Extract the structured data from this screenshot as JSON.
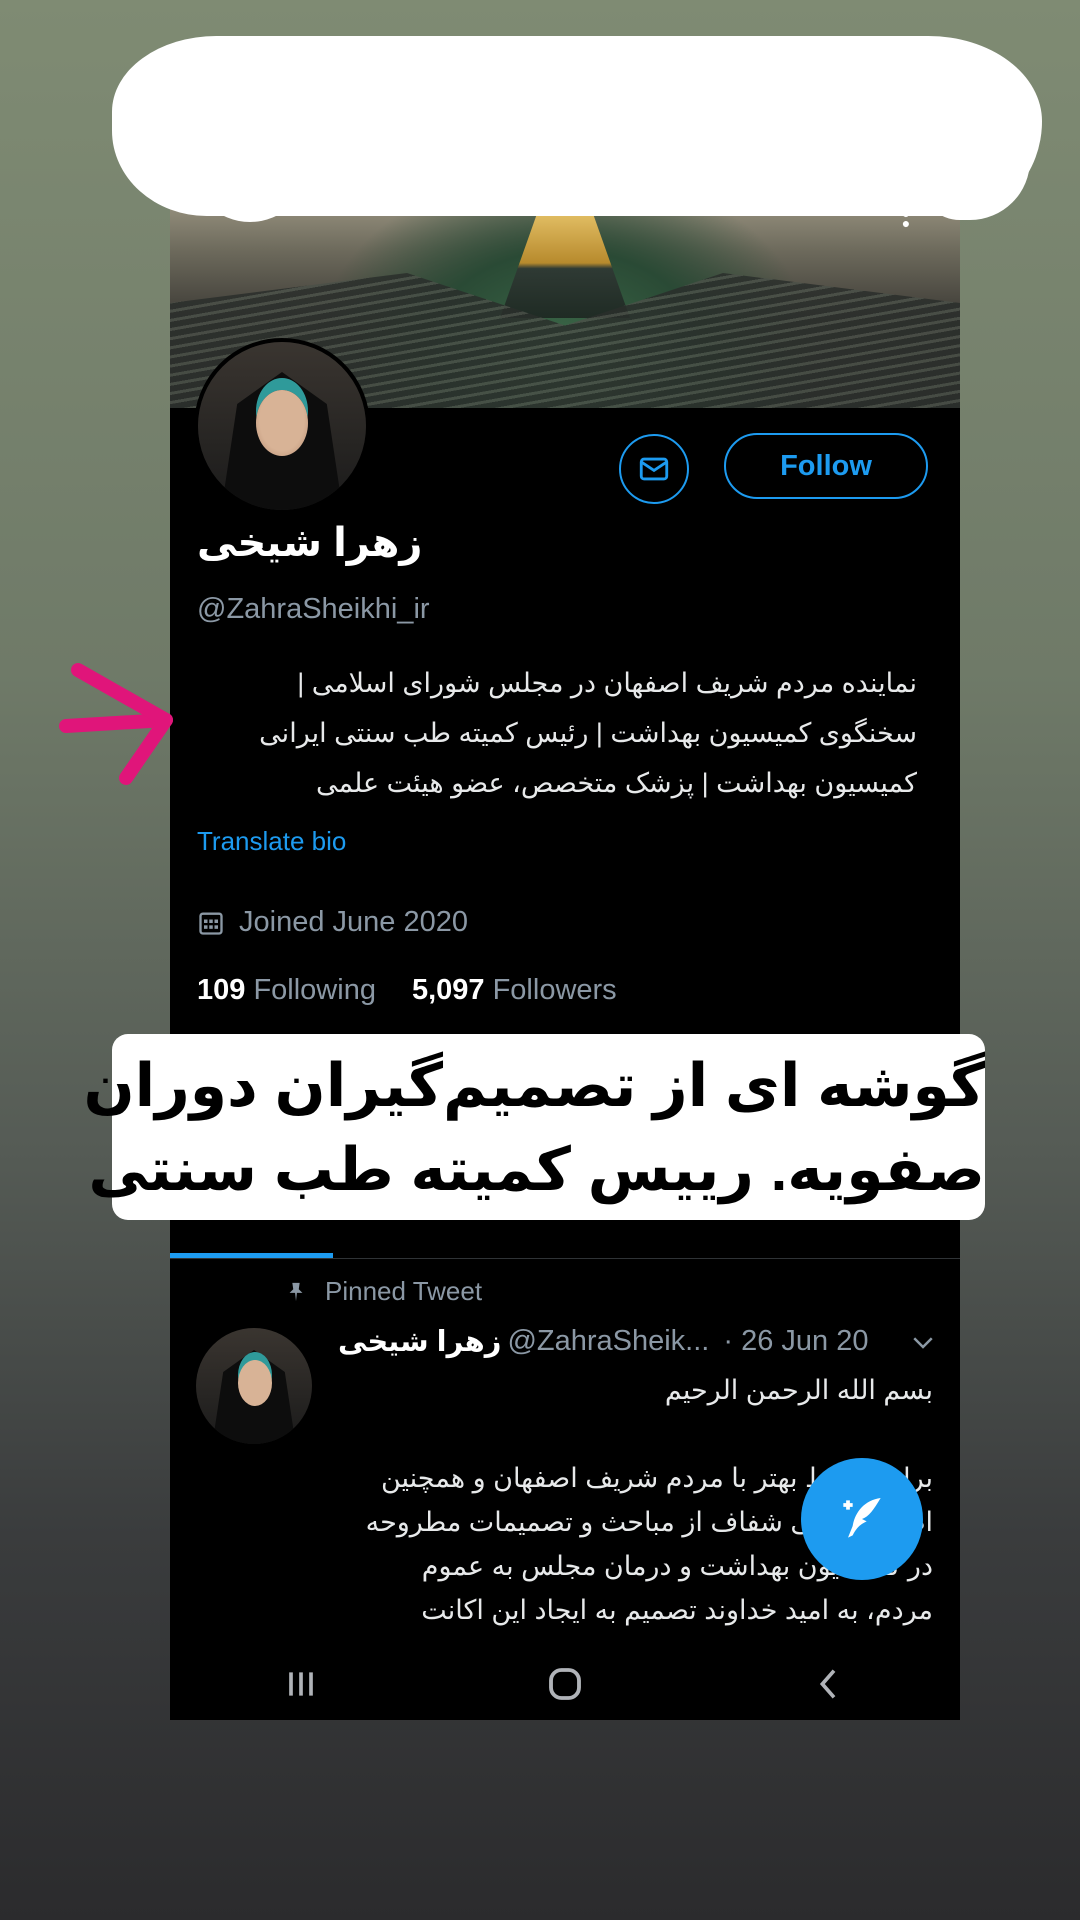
{
  "profile": {
    "follow_label": "Follow",
    "name": "زهرا شیخی",
    "handle": "@ZahraSheikhi_ir",
    "bio": [
      "نماینده مردم شریف اصفهان در مجلس شورای اسلامی |",
      "سخنگوی کمیسیون بهداشت | رئیس کمیته طب سنتی ایرانی",
      "کمیسیون بهداشت | پزشک متخصص، عضو هیئت علمی"
    ],
    "translate_label": "Translate bio",
    "joined": "Joined June 2020",
    "following_count": "109",
    "following_label": "Following",
    "followers_count": "5,097",
    "followers_label": "Followers"
  },
  "pinned": {
    "label": "Pinned Tweet",
    "author": "زهرا شیخی",
    "handle": "@ZahraSheik...",
    "date": "· 26 Jun 20",
    "lines": [
      "بسم الله الرحمن الرحیم",
      "",
      "برای ارتباط بهتر با مردم شریف اصفهان و همچنین",
      "اطلاع رسانی شفاف از مباحث و تصمیمات مطروحه",
      "در کمیسیون بهداشت و درمان مجلس به عموم",
      "مردم، به امید خداوند تصمیم به ایجاد این اکانت"
    ]
  },
  "caption": {
    "lines": [
      "گوشه ای از تصمیم‌گیران دوران",
      "صفویه. رییس کمیته طب سنتی"
    ]
  },
  "icons": [
    "mail-icon",
    "calendar-icon",
    "pin-icon",
    "chevron-down-icon",
    "compose-icon",
    "recents-icon",
    "home-icon",
    "back-icon",
    "more-icon"
  ],
  "colors": {
    "accent": "#1d9bf0",
    "background": "#000000",
    "annotation_arrow": "#e0157a"
  }
}
